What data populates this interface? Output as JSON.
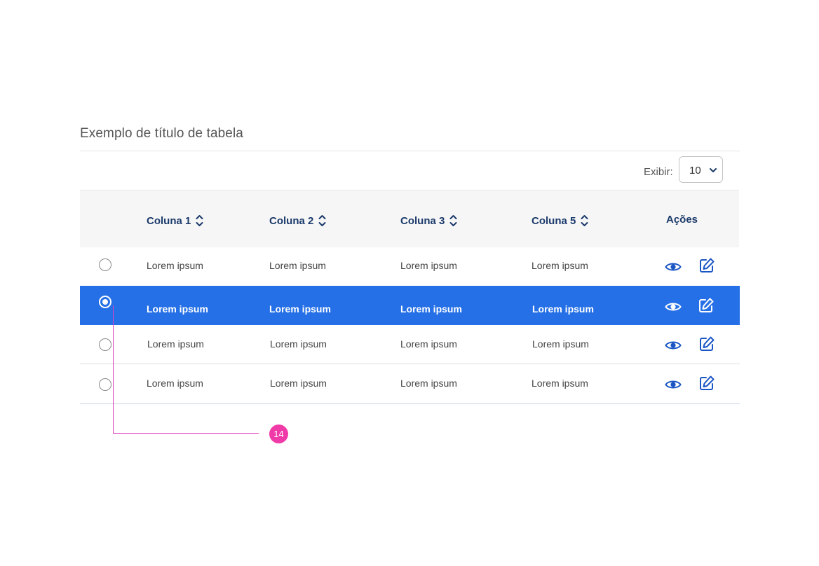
{
  "table": {
    "title": "Exemplo de título de tabela",
    "page_size": {
      "label": "Exibir:",
      "value": "10"
    },
    "columns": [
      {
        "label": "Coluna 1",
        "sortable": true
      },
      {
        "label": "Coluna 2",
        "sortable": true
      },
      {
        "label": "Coluna 3",
        "sortable": true
      },
      {
        "label": "Coluna 5",
        "sortable": true
      },
      {
        "label": "Ações",
        "sortable": false
      }
    ],
    "rows": [
      {
        "selected": false,
        "cells": [
          "Lorem ipsum",
          "Lorem ipsum",
          "Lorem ipsum",
          "Lorem ipsum"
        ]
      },
      {
        "selected": true,
        "cells": [
          "Lorem ipsum",
          "Lorem ipsum",
          "Lorem ipsum",
          "Lorem ipsum"
        ]
      },
      {
        "selected": false,
        "cells": [
          "Lorem ipsum",
          "Lorem ipsum",
          "Lorem ipsum",
          "Lorem ipsum"
        ]
      },
      {
        "selected": false,
        "cells": [
          "Lorem ipsum",
          "Lorem ipsum",
          "Lorem ipsum",
          "Lorem ipsum"
        ]
      }
    ],
    "row_actions": [
      "eye-icon",
      "edit-icon"
    ]
  },
  "annotation": {
    "number": "14"
  },
  "colors": {
    "header_text": "#1b3a6b",
    "selected_row": "#2570e6",
    "action_icon": "#1a56c4",
    "annotation": "#f03aa8"
  }
}
